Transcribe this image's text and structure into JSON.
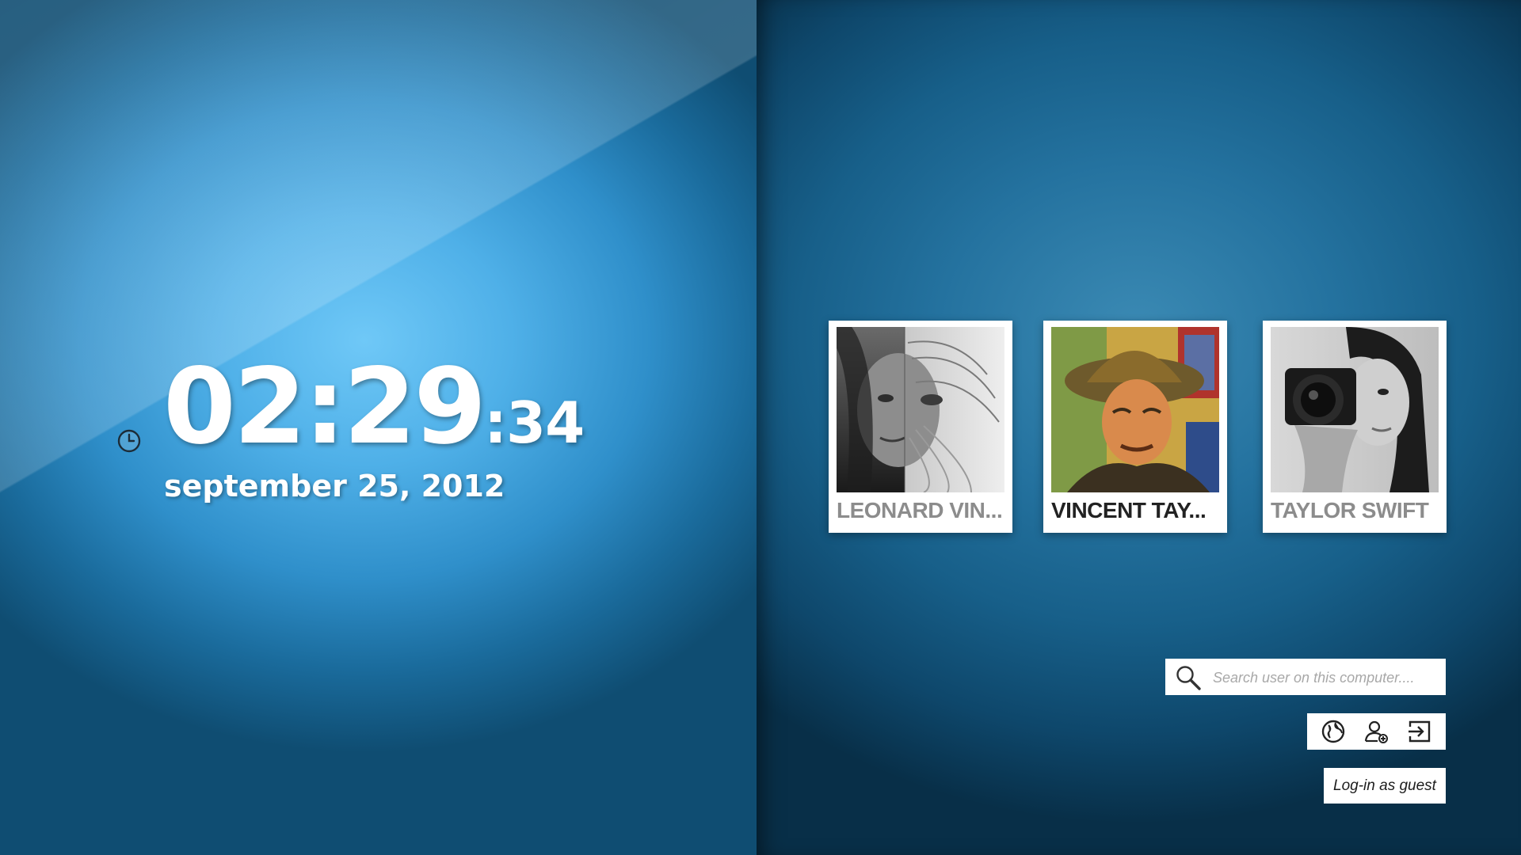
{
  "clock": {
    "hours_minutes": "02:29",
    "seconds": ":34",
    "date": "september 25, 2012"
  },
  "users": [
    {
      "name": "LEONARD VIN...",
      "photo_description": "mona-lisa-leonardo-split-portrait",
      "active": false
    },
    {
      "name": "VINCENT TAY...",
      "photo_description": "gauguin-self-portrait-painting",
      "active": true
    },
    {
      "name": "TAYLOR  SWIFT",
      "photo_description": "woman-with-camera-bw-photo",
      "active": false
    }
  ],
  "search": {
    "placeholder": "Search user on this computer....",
    "value": "",
    "icon": "search-icon"
  },
  "actions": [
    {
      "icon": "globe-icon"
    },
    {
      "icon": "add-user-icon"
    },
    {
      "icon": "sign-in-icon"
    }
  ],
  "guest": {
    "label": "Log-in as guest"
  },
  "colors": {
    "left_bg": "#4fb0e8",
    "right_bg": "#175f89",
    "card_bg": "#ffffff",
    "name_dim": "#8c8c8c",
    "name_active": "#222222"
  }
}
